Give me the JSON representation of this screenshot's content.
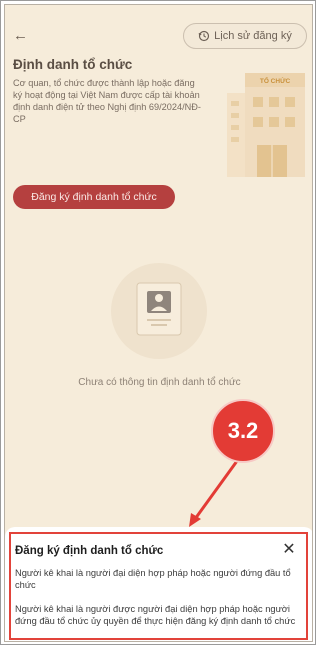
{
  "header": {
    "back_icon": "arrow-left-icon",
    "history_label": "Lịch sử đăng ký",
    "history_icon": "history-clock-icon"
  },
  "page": {
    "title": "Định danh tổ chức",
    "description": "Cơ quan, tổ chức được thành lập hoặc đăng ký hoạt động tại Việt Nam được cấp tài khoản định danh điện tử theo Nghị định 69/2024/NĐ-CP",
    "building_sign": "TỔ CHỨC",
    "register_button": "Đăng ký định danh tổ chức",
    "empty_state": "Chưa có thông tin định danh tổ chức"
  },
  "callout": {
    "label": "3.2"
  },
  "sheet": {
    "title": "Đăng ký định danh tổ chức",
    "close_icon": "close-icon",
    "options": [
      "Người kê khai là người đại diện hợp pháp hoặc người đứng đầu tổ chức",
      "Người kê khai là người được người đại diện hợp pháp hoặc người đứng đầu tổ chức ủy quyền để thực hiện đăng ký định danh tổ chức"
    ]
  },
  "colors": {
    "accent": "#b5403f",
    "callout": "#e33b35",
    "overlay_bg": "#f6ecda"
  }
}
